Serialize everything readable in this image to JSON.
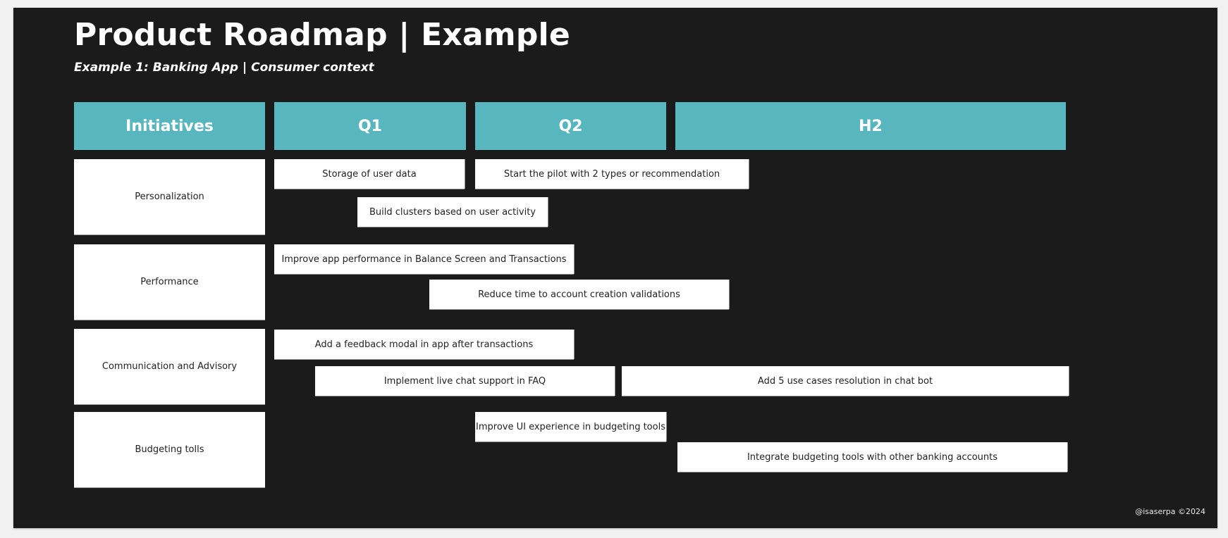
{
  "title": "Product Roadmap | Example",
  "subtitle": "Example 1: Banking App | Consumer context",
  "colors": {
    "background": "#1b1b1b",
    "header": "#58b7be",
    "card": "#ffffff",
    "page": "#f1f1f1"
  },
  "columns": [
    "Initiatives",
    "Q1",
    "Q2",
    "H2"
  ],
  "initiatives": [
    {
      "name": "Personalization",
      "tasks": [
        {
          "label": "Storage of user data",
          "timeframe": "Q1"
        },
        {
          "label": "Start the pilot with 2 types or recommendation",
          "timeframe": "Q2 to early H2"
        },
        {
          "label": "Build clusters based on user activity",
          "timeframe": "mid Q1 to mid Q2"
        }
      ]
    },
    {
      "name": "Performance",
      "tasks": [
        {
          "label": "Improve app performance in Balance Screen and Transactions",
          "timeframe": "Q1 to mid Q2"
        },
        {
          "label": "Reduce time to account creation validations",
          "timeframe": "late Q1 to Q2 end"
        }
      ]
    },
    {
      "name": "Communication and Advisory",
      "tasks": [
        {
          "label": "Add a feedback modal  in app after transactions",
          "timeframe": "Q1 to mid Q2"
        },
        {
          "label": "Implement live chat support in FAQ",
          "timeframe": "early Q1 to mid Q2"
        },
        {
          "label": "Add 5 use cases resolution in chat bot",
          "timeframe": "late Q2 to H2"
        }
      ]
    },
    {
      "name": "Budgeting tolls",
      "tasks": [
        {
          "label": "Improve UI experience in budgeting tools",
          "timeframe": "Q2"
        },
        {
          "label": "Integrate budgeting tools with other banking accounts",
          "timeframe": "H2"
        }
      ]
    }
  ],
  "footer": "@isaserpa ©2024"
}
